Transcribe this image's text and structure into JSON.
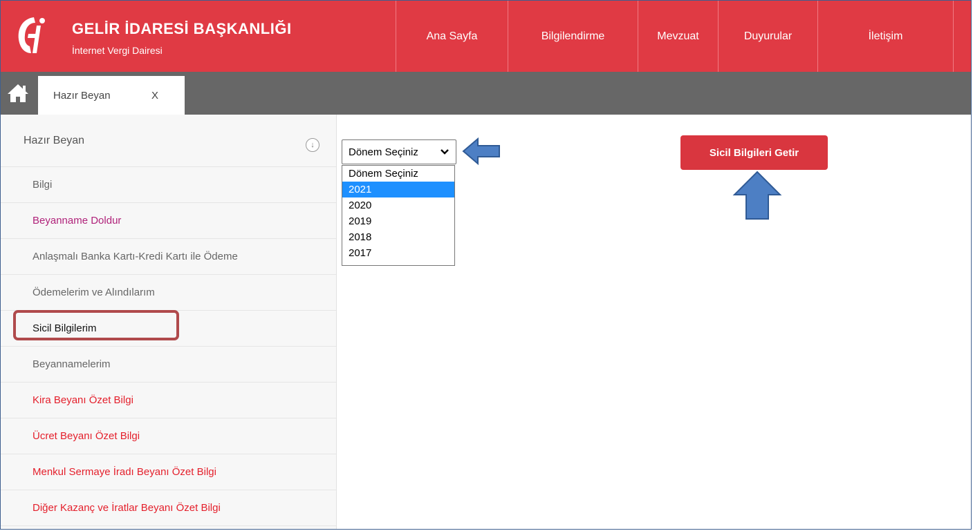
{
  "colors": {
    "header_red": "#e03a44",
    "tabbar_gray": "#676767",
    "button_red": "#d9363f",
    "selected_blue": "#1e90ff",
    "highlight_border": "#b04a4c",
    "arrow_blue": "#4d7fc4"
  },
  "brand": {
    "title": "GELİR İDARESİ BAŞKANLIĞI",
    "subtitle": "İnternet Vergi Dairesi",
    "logo_icon": "gib-logo-icon"
  },
  "nav": [
    {
      "label": "Ana Sayfa"
    },
    {
      "label": "Bilgilendirme"
    },
    {
      "label": "Mevzuat"
    },
    {
      "label": "Duyurular"
    },
    {
      "label": "İletişim"
    }
  ],
  "tabbar": {
    "home_icon": "home-icon",
    "tab_label": "Hazır Beyan",
    "tab_close": "X"
  },
  "sidebar": {
    "heading": "Hazır Beyan",
    "collapse_symbol": "↓",
    "items": [
      {
        "label": "Bilgi",
        "color": "#666666"
      },
      {
        "label": "Beyanname Doldur",
        "color": "#b0227a"
      },
      {
        "label": "Anlaşmalı Banka Kartı-Kredi Kartı ile Ödeme",
        "color": "#666666"
      },
      {
        "label": "Ödemelerim ve Alındılarım",
        "color": "#666666"
      },
      {
        "label": "Sicil Bilgilerim",
        "color": "#111111"
      },
      {
        "label": "Beyannamelerim",
        "color": "#666666"
      },
      {
        "label": "Kira Beyanı Özet Bilgi",
        "color": "#e41f2b"
      },
      {
        "label": "Ücret Beyanı Özet Bilgi",
        "color": "#e41f2b"
      },
      {
        "label": "Menkul Sermaye İradı Beyanı Özet Bilgi",
        "color": "#e41f2b"
      },
      {
        "label": "Diğer Kazanç ve İratlar Beyanı Özet Bilgi",
        "color": "#e41f2b"
      }
    ]
  },
  "main": {
    "period_select": {
      "value": "Dönem Seçiniz",
      "options": [
        "Dönem Seçiniz",
        "2021",
        "2020",
        "2019",
        "2018",
        "2017"
      ],
      "highlighted": "2021"
    },
    "getir_button": "Sicil Bilgileri Getir"
  }
}
